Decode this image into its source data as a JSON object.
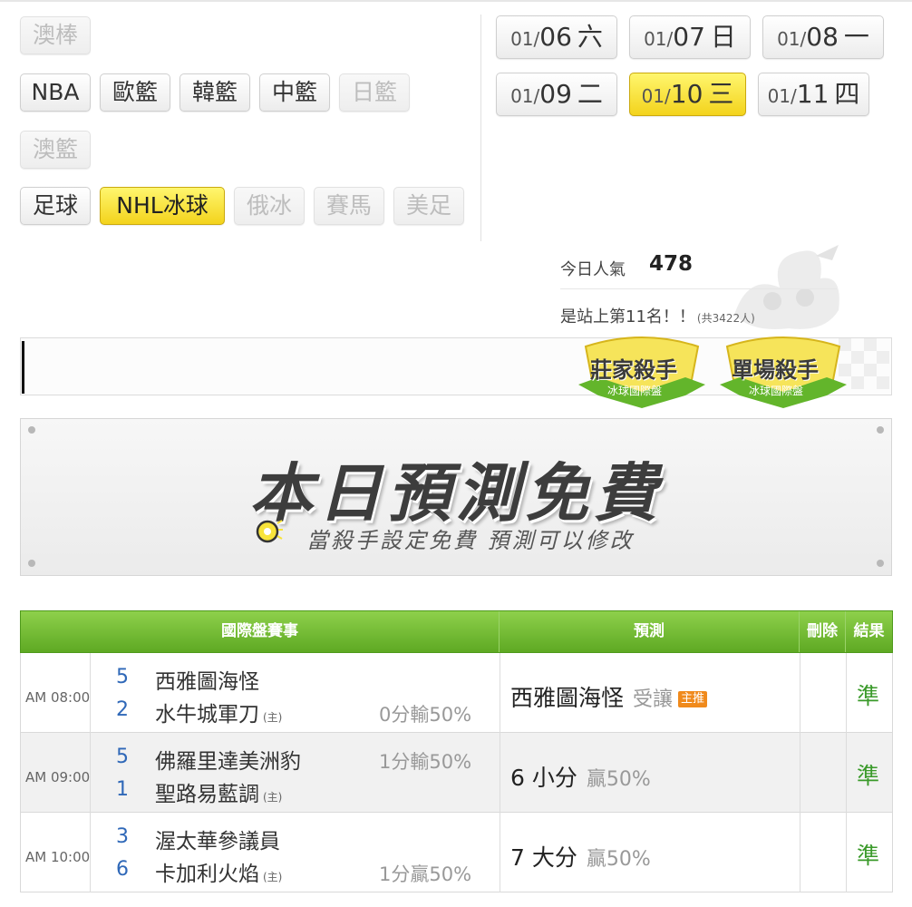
{
  "categories": [
    {
      "label": "澳棒",
      "state": "disabled"
    },
    {
      "label": "NBA",
      "state": "normal"
    },
    {
      "label": "歐籃",
      "state": "normal"
    },
    {
      "label": "韓籃",
      "state": "normal"
    },
    {
      "label": "中籃",
      "state": "normal"
    },
    {
      "label": "日籃",
      "state": "disabled"
    },
    {
      "label": "澳籃",
      "state": "disabled"
    },
    {
      "label": "足球",
      "state": "normal"
    },
    {
      "label": "NHL冰球",
      "state": "active"
    },
    {
      "label": "俄冰",
      "state": "disabled"
    },
    {
      "label": "賽馬",
      "state": "disabled"
    },
    {
      "label": "美足",
      "state": "disabled"
    }
  ],
  "dates": [
    {
      "month": "01/",
      "day": "06",
      "weekday": "六",
      "active": false
    },
    {
      "month": "01/",
      "day": "07",
      "weekday": "日",
      "active": false
    },
    {
      "month": "01/",
      "day": "08",
      "weekday": "一",
      "active": false
    },
    {
      "month": "01/",
      "day": "09",
      "weekday": "二",
      "active": false
    },
    {
      "month": "01/",
      "day": "10",
      "weekday": "三",
      "active": true
    },
    {
      "month": "01/",
      "day": "11",
      "weekday": "四",
      "active": false
    }
  ],
  "popularity": {
    "label": "今日人氣",
    "count": "478",
    "rank_text": "是站上第11名！！",
    "total_text": "(共3422人)"
  },
  "badges": [
    {
      "title": "莊家殺手",
      "subtitle": "冰球國際盤"
    },
    {
      "title": "單場殺手",
      "subtitle": "冰球國際盤"
    }
  ],
  "banner": {
    "title": "本日預測免費",
    "subtitle": "當殺手設定免費  預測可以修改"
  },
  "table": {
    "headers": {
      "match": "國際盤賽事",
      "prediction": "預測",
      "delete": "刪除",
      "result": "結果"
    },
    "rows": [
      {
        "time": "AM 08:00",
        "team1_num": "5",
        "team1": "西雅圖海怪",
        "team1_home": "",
        "odds1": "",
        "team2_num": "2",
        "team2": "水牛城軍刀",
        "team2_home": "(主)",
        "odds2": "0分輸50%",
        "prediction": "西雅圖海怪",
        "prediction_note": "受讓",
        "prediction_tag": "主推",
        "result": "準"
      },
      {
        "time": "AM 09:00",
        "team1_num": "5",
        "team1": "佛羅里達美洲豹",
        "team1_home": "",
        "odds1": "1分輸50%",
        "team2_num": "1",
        "team2": "聖路易藍調",
        "team2_home": "(主)",
        "odds2": "",
        "prediction": "6 小分",
        "prediction_note": "贏50%",
        "prediction_tag": "",
        "result": "準"
      },
      {
        "time": "AM 10:00",
        "team1_num": "3",
        "team1": "渥太華參議員",
        "team1_home": "",
        "odds1": "",
        "team2_num": "6",
        "team2": "卡加利火焰",
        "team2_home": "(主)",
        "odds2": "1分贏50%",
        "prediction": "7 大分",
        "prediction_note": "贏50%",
        "prediction_tag": "",
        "result": "準"
      }
    ]
  }
}
